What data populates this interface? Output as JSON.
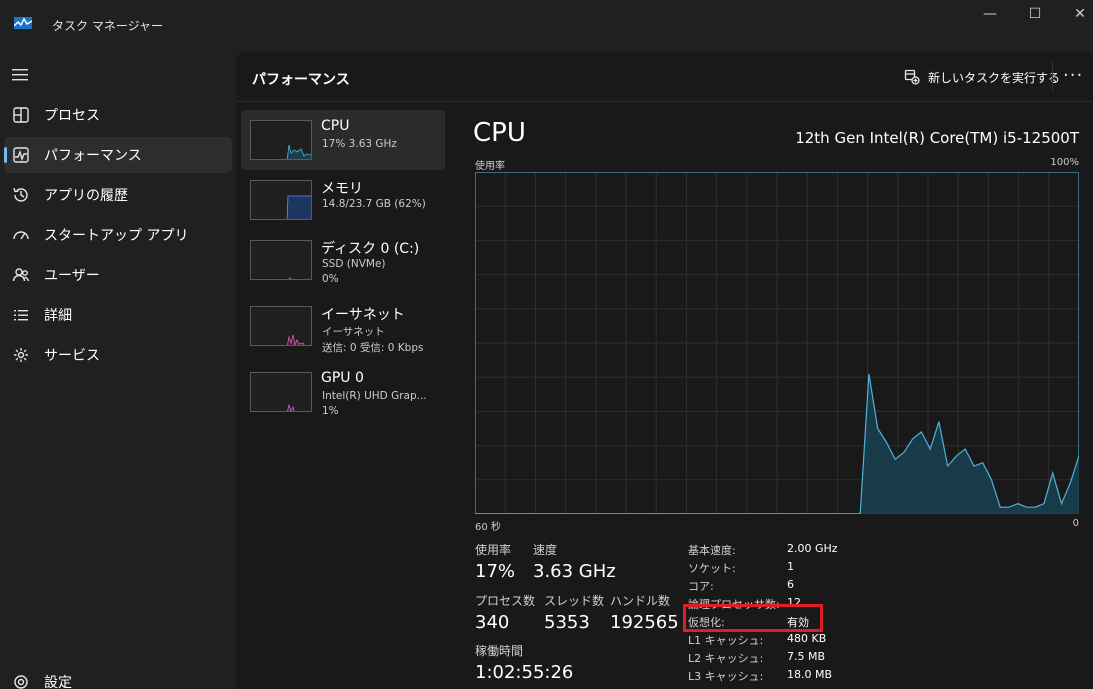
{
  "window": {
    "title": "タスク マネージャー",
    "minimize_glyph": "—",
    "maximize_glyph": "☐",
    "close_glyph": "✕"
  },
  "sidebar": {
    "items": [
      {
        "label": "プロセス",
        "icon": "processes-icon"
      },
      {
        "label": "パフォーマンス",
        "icon": "performance-icon",
        "active": true
      },
      {
        "label": "アプリの履歴",
        "icon": "history-icon"
      },
      {
        "label": "スタートアップ アプリ",
        "icon": "startup-icon"
      },
      {
        "label": "ユーザー",
        "icon": "users-icon"
      },
      {
        "label": "詳細",
        "icon": "details-icon"
      },
      {
        "label": "サービス",
        "icon": "services-icon"
      }
    ],
    "settings_label": "設定"
  },
  "header": {
    "title": "パフォーマンス",
    "run_task_label": "新しいタスクを実行する",
    "more_glyph": "···"
  },
  "devices": [
    {
      "name": "CPU",
      "line1": "17%  3.63 GHz",
      "line2": "",
      "color": "#4fb3d9"
    },
    {
      "name": "メモリ",
      "line1": "14.8/23.7 GB (62%)",
      "line2": "",
      "color": "#6a8fe0"
    },
    {
      "name": "ディスク 0 (C:)",
      "line1": "SSD (NVMe)",
      "line2": "0%",
      "color": "#9ec25a"
    },
    {
      "name": "イーサネット",
      "line1": "イーサネット",
      "line2": "送信: 0 受信: 0 Kbps",
      "color": "#d65fa8"
    },
    {
      "name": "GPU 0",
      "line1": "Intel(R) UHD Grap...",
      "line2": "1%",
      "color": "#b46fd6"
    }
  ],
  "cpu": {
    "title": "CPU",
    "model": "12th Gen Intel(R) Core(TM) i5-12500T",
    "graph_top_left": "使用率",
    "graph_top_right": "100%",
    "graph_bottom_left": "60 秒",
    "graph_bottom_right": "0",
    "usage_history": [
      0,
      0,
      0,
      0,
      0,
      0,
      0,
      0,
      0,
      0,
      0,
      0,
      0,
      0,
      0,
      0,
      0,
      0,
      0,
      0,
      0,
      0,
      0,
      0,
      0,
      0,
      0,
      0,
      0,
      0,
      0,
      0,
      0,
      0,
      0,
      0,
      0,
      0,
      0,
      0,
      0,
      0,
      0,
      0,
      0,
      41,
      25,
      21,
      16,
      18,
      22,
      24,
      19,
      27,
      14,
      17,
      19,
      14,
      15,
      10,
      2,
      2,
      3,
      2,
      2,
      3,
      12,
      3,
      9,
      17
    ]
  },
  "stats": {
    "utilization_label": "使用率",
    "utilization_value": "17%",
    "speed_label": "速度",
    "speed_value": "3.63 GHz",
    "processes_label": "プロセス数",
    "processes_value": "340",
    "threads_label": "スレッド数",
    "threads_value": "5353",
    "handles_label": "ハンドル数",
    "handles_value": "192565",
    "uptime_label": "稼働時間",
    "uptime_value": "1:02:55:26"
  },
  "specs": [
    {
      "key": "基本速度:",
      "value": "2.00 GHz"
    },
    {
      "key": "ソケット:",
      "value": "1"
    },
    {
      "key": "コア:",
      "value": "6"
    },
    {
      "key": "論理プロセッサ数:",
      "value": "12"
    },
    {
      "key": "仮想化:",
      "value": "有効"
    },
    {
      "key": "L1 キャッシュ:",
      "value": "480 KB"
    },
    {
      "key": "L2 キャッシュ:",
      "value": "7.5 MB"
    },
    {
      "key": "L3 キャッシュ:",
      "value": "18.0 MB"
    }
  ],
  "colors": {
    "accent": "#76b9ed",
    "cpu_line": "#4fb3d9",
    "highlight": "#e01e26"
  }
}
